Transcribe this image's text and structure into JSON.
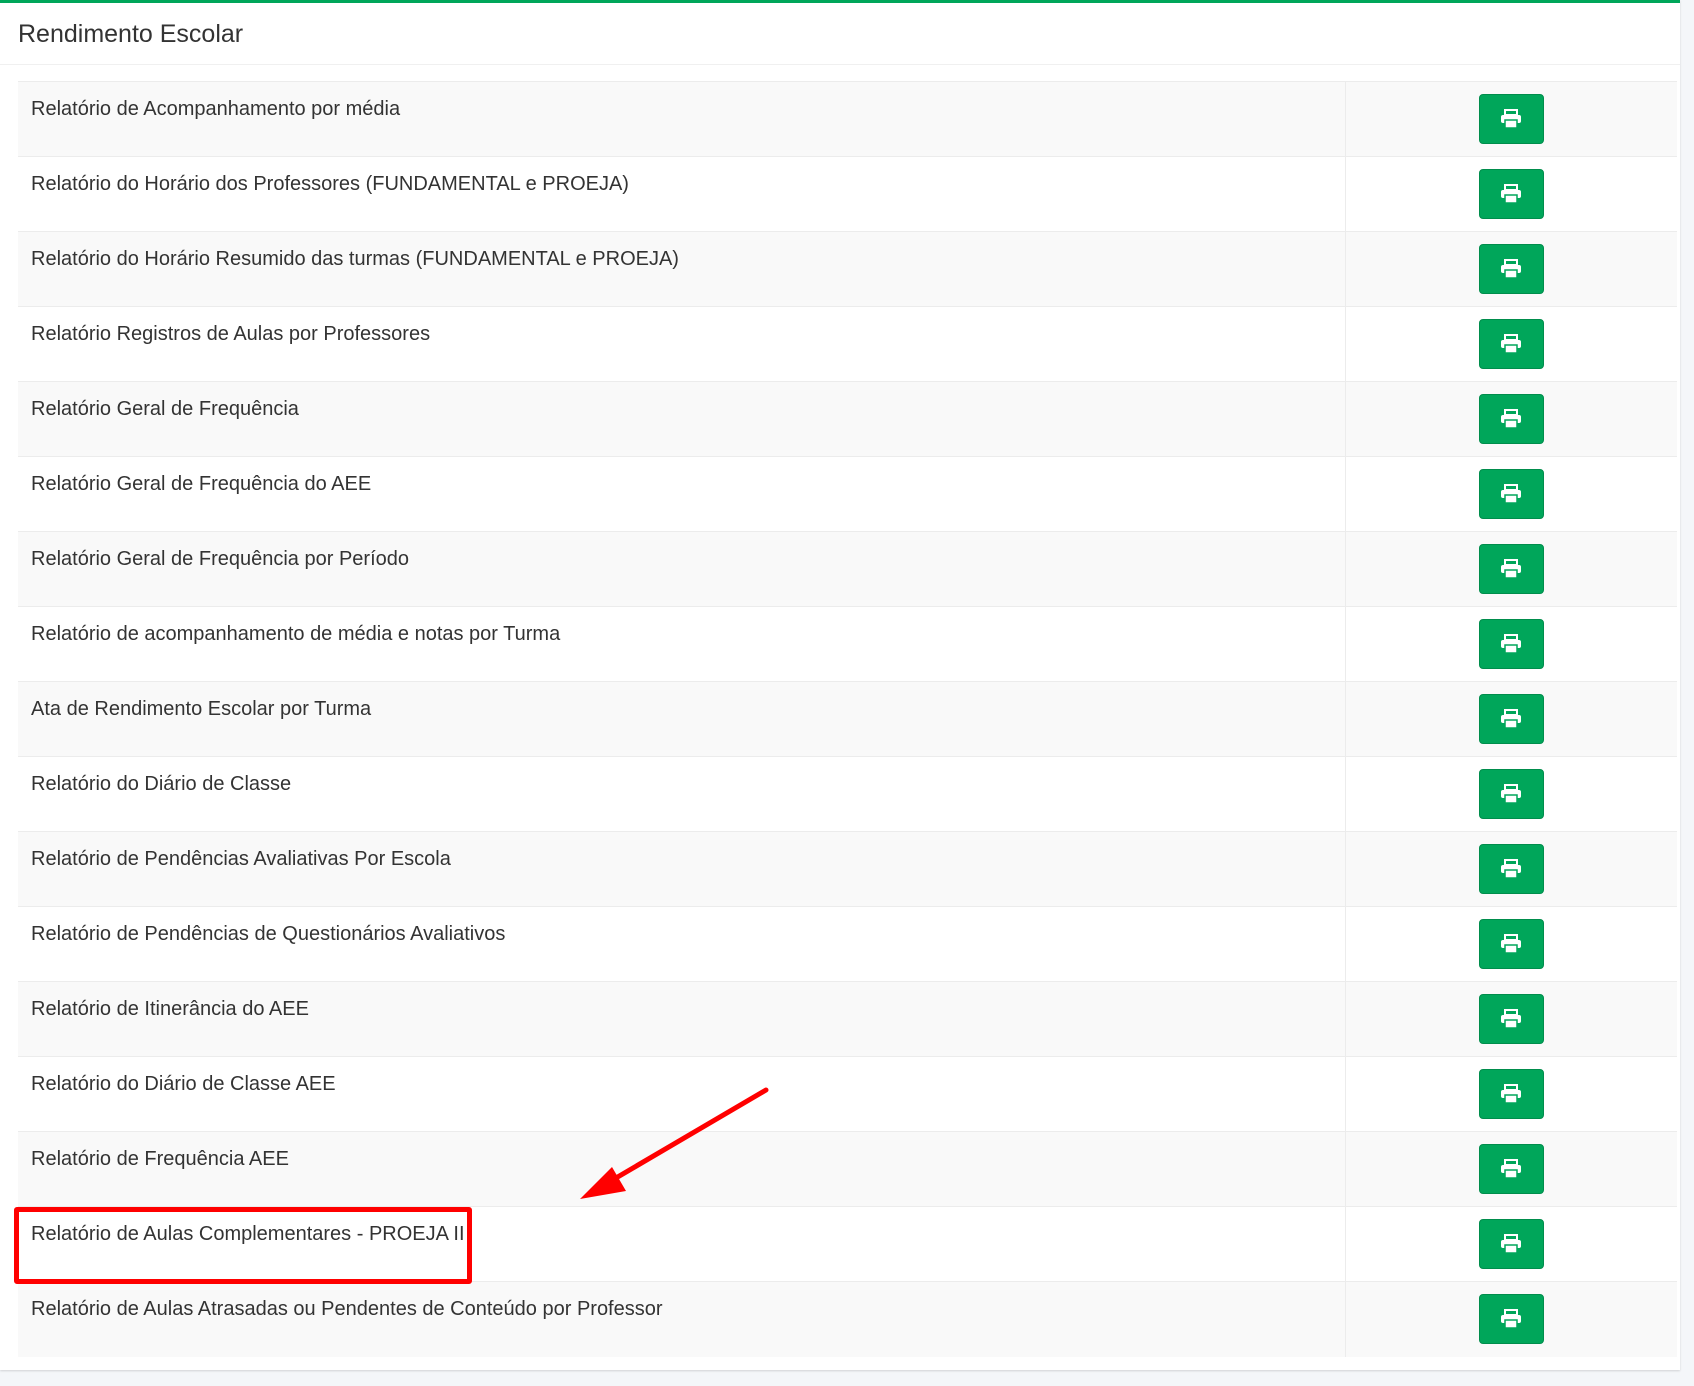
{
  "panel": {
    "title": "Rendimento Escolar"
  },
  "reports": [
    {
      "name": "Relatório de Acompanhamento por média",
      "action_icon": "print-icon"
    },
    {
      "name": "Relatório do Horário dos Professores (FUNDAMENTAL e PROEJA)",
      "action_icon": "print-icon"
    },
    {
      "name": "Relatório do Horário Resumido das turmas (FUNDAMENTAL e PROEJA)",
      "action_icon": "print-icon"
    },
    {
      "name": "Relatório Registros de Aulas por Professores",
      "action_icon": "print-icon"
    },
    {
      "name": "Relatório Geral de Frequência",
      "action_icon": "print-icon"
    },
    {
      "name": "Relatório Geral de Frequência do AEE",
      "action_icon": "print-icon"
    },
    {
      "name": "Relatório Geral de Frequência por Período",
      "action_icon": "print-icon"
    },
    {
      "name": "Relatório de acompanhamento de média e notas por Turma",
      "action_icon": "print-icon"
    },
    {
      "name": "Ata de Rendimento Escolar por Turma",
      "action_icon": "print-icon"
    },
    {
      "name": "Relatório do Diário de Classe",
      "action_icon": "print-icon"
    },
    {
      "name": "Relatório de Pendências Avaliativas Por Escola",
      "action_icon": "print-icon"
    },
    {
      "name": "Relatório de Pendências de Questionários Avaliativos",
      "action_icon": "print-icon"
    },
    {
      "name": "Relatório de Itinerância do AEE",
      "action_icon": "print-icon"
    },
    {
      "name": "Relatório do Diário de Classe AEE",
      "action_icon": "print-icon"
    },
    {
      "name": "Relatório de Frequência AEE",
      "action_icon": "print-icon"
    },
    {
      "name": "Relatório de Aulas Complementares - PROEJA II",
      "action_icon": "print-icon",
      "highlighted": true
    },
    {
      "name": "Relatório de Aulas Atrasadas ou Pendentes de Conteúdo por Professor",
      "action_icon": "print-icon"
    }
  ],
  "colors": {
    "accent": "#00a65a",
    "annotation": "#ff0000"
  }
}
